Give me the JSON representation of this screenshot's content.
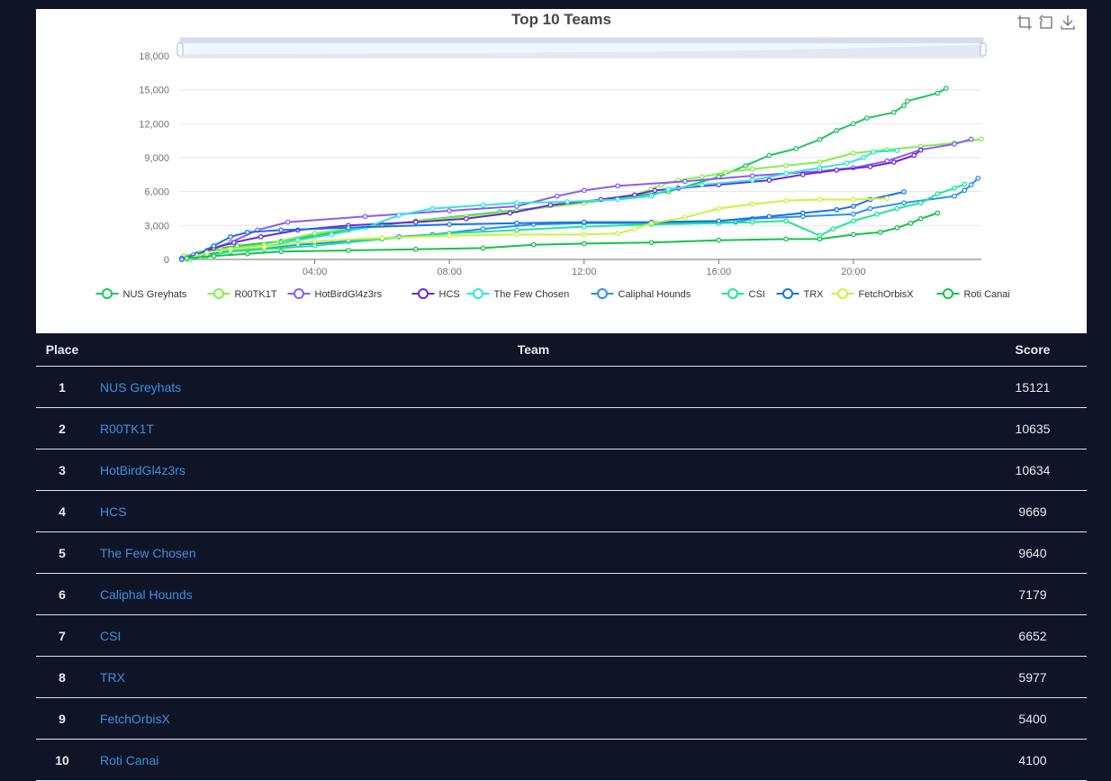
{
  "colors": {
    "page_bg": "#0f1527",
    "link": "#3d8fe0",
    "series": [
      "#22c55e",
      "#84ef4a",
      "#8b5cf6",
      "#6d28d9",
      "#2ee6de",
      "#2b8ff0",
      "#1ee88f",
      "#1673e6",
      "#cdf23e",
      "#16c24a"
    ]
  },
  "toolbox": {
    "icons": [
      "zoom-area-icon",
      "zoom-reset-icon",
      "download-icon"
    ]
  },
  "chart_data": {
    "type": "line",
    "title": "Top 10 Teams",
    "xlabel": "",
    "ylabel": "",
    "xlim": [
      0,
      23.8
    ],
    "ylim": [
      0,
      18000
    ],
    "yticks": [
      0,
      3000,
      6000,
      9000,
      12000,
      15000,
      18000
    ],
    "ytick_labels": [
      "0",
      "3,000",
      "6,000",
      "9,000",
      "12,000",
      "15,000",
      "18,000"
    ],
    "xticks": [
      4,
      8,
      12,
      16,
      20
    ],
    "xtick_labels": [
      "04:00",
      "08:00",
      "12:00",
      "16:00",
      "20:00"
    ],
    "grid": true,
    "legend_position": "bottom",
    "series": [
      {
        "name": "NUS Greyhats",
        "points": [
          [
            0.1,
            200
          ],
          [
            0.5,
            500
          ],
          [
            1.0,
            900
          ],
          [
            1.7,
            1200
          ],
          [
            3.0,
            1600
          ],
          [
            5.0,
            2600
          ],
          [
            7.0,
            3400
          ],
          [
            9.5,
            4200
          ],
          [
            12.0,
            5000
          ],
          [
            14.5,
            6000
          ],
          [
            16.0,
            7300
          ],
          [
            16.8,
            8300
          ],
          [
            17.5,
            9200
          ],
          [
            18.3,
            9800
          ],
          [
            19.0,
            10600
          ],
          [
            19.5,
            11400
          ],
          [
            20.0,
            12000
          ],
          [
            20.4,
            12500
          ],
          [
            21.2,
            13000
          ],
          [
            21.5,
            13600
          ],
          [
            21.6,
            14000
          ],
          [
            22.5,
            14700
          ],
          [
            22.75,
            15121
          ]
        ]
      },
      {
        "name": "R00TK1T",
        "points": [
          [
            0.1,
            300
          ],
          [
            0.6,
            600
          ],
          [
            1.2,
            900
          ],
          [
            2.5,
            1300
          ],
          [
            4.0,
            2300
          ],
          [
            6.0,
            3100
          ],
          [
            8.5,
            3800
          ],
          [
            10.0,
            4300
          ],
          [
            12.0,
            5000
          ],
          [
            13.5,
            5700
          ],
          [
            14.0,
            6200
          ],
          [
            14.3,
            6600
          ],
          [
            14.8,
            7000
          ],
          [
            15.5,
            7300
          ],
          [
            16.2,
            7700
          ],
          [
            17.0,
            8000
          ],
          [
            18.0,
            8300
          ],
          [
            19.0,
            8600
          ],
          [
            20.0,
            9400
          ],
          [
            21.0,
            9700
          ],
          [
            22.0,
            10000
          ],
          [
            23.0,
            10300
          ],
          [
            23.8,
            10635
          ]
        ]
      },
      {
        "name": "HotBirdGl4z3rs",
        "points": [
          [
            0.05,
            100
          ],
          [
            0.4,
            400
          ],
          [
            0.8,
            800
          ],
          [
            1.5,
            1500
          ],
          [
            2.3,
            2600
          ],
          [
            3.2,
            3300
          ],
          [
            5.5,
            3800
          ],
          [
            8.0,
            4300
          ],
          [
            10.0,
            4700
          ],
          [
            11.2,
            5600
          ],
          [
            12.0,
            6100
          ],
          [
            13.0,
            6500
          ],
          [
            15.0,
            6900
          ],
          [
            17.0,
            7400
          ],
          [
            19.0,
            7800
          ],
          [
            20.0,
            8100
          ],
          [
            21.0,
            8700
          ],
          [
            22.0,
            9700
          ],
          [
            23.0,
            10200
          ],
          [
            23.5,
            10634
          ]
        ]
      },
      {
        "name": "HCS",
        "points": [
          [
            0.05,
            0
          ],
          [
            0.5,
            400
          ],
          [
            1.0,
            1000
          ],
          [
            1.6,
            1500
          ],
          [
            2.4,
            2000
          ],
          [
            3.5,
            2600
          ],
          [
            5.0,
            3000
          ],
          [
            7.0,
            3300
          ],
          [
            8.5,
            3600
          ],
          [
            9.8,
            4100
          ],
          [
            11.0,
            4800
          ],
          [
            12.5,
            5300
          ],
          [
            13.5,
            5700
          ],
          [
            14.1,
            6100
          ],
          [
            14.8,
            6300
          ],
          [
            16.0,
            6600
          ],
          [
            17.5,
            7000
          ],
          [
            18.5,
            7500
          ],
          [
            19.5,
            7900
          ],
          [
            20.5,
            8200
          ],
          [
            21.2,
            8600
          ],
          [
            21.8,
            9200
          ],
          [
            22.0,
            9669
          ]
        ]
      },
      {
        "name": "The Few Chosen",
        "points": [
          [
            0.3,
            0
          ],
          [
            0.7,
            300
          ],
          [
            1.5,
            700
          ],
          [
            2.5,
            1100
          ],
          [
            3.5,
            1700
          ],
          [
            4.5,
            2200
          ],
          [
            5.5,
            2800
          ],
          [
            6.5,
            3900
          ],
          [
            7.5,
            4500
          ],
          [
            9.0,
            4800
          ],
          [
            10.0,
            5000
          ],
          [
            11.5,
            5100
          ],
          [
            13.0,
            5300
          ],
          [
            14.0,
            5600
          ],
          [
            14.5,
            6200
          ],
          [
            15.5,
            6600
          ],
          [
            17.0,
            7000
          ],
          [
            18.0,
            7600
          ],
          [
            19.0,
            8100
          ],
          [
            19.8,
            8500
          ],
          [
            20.3,
            9000
          ],
          [
            20.6,
            9500
          ],
          [
            21.3,
            9640
          ]
        ]
      },
      {
        "name": "Caliphal Hounds",
        "points": [
          [
            0.05,
            100
          ],
          [
            0.6,
            400
          ],
          [
            1.2,
            700
          ],
          [
            2.5,
            1000
          ],
          [
            3.5,
            1300
          ],
          [
            5.0,
            1600
          ],
          [
            6.5,
            2000
          ],
          [
            7.5,
            2200
          ],
          [
            9.0,
            2700
          ],
          [
            10.5,
            3100
          ],
          [
            12.0,
            3200
          ],
          [
            14.0,
            3200
          ],
          [
            16.5,
            3300
          ],
          [
            17.0,
            3600
          ],
          [
            18.5,
            3800
          ],
          [
            20.0,
            4000
          ],
          [
            20.5,
            4500
          ],
          [
            21.5,
            5000
          ],
          [
            23.0,
            5600
          ],
          [
            23.3,
            6100
          ],
          [
            23.5,
            6600
          ],
          [
            23.7,
            7179
          ]
        ]
      },
      {
        "name": "CSI",
        "points": [
          [
            0.2,
            0
          ],
          [
            0.8,
            300
          ],
          [
            1.5,
            700
          ],
          [
            2.5,
            900
          ],
          [
            4.0,
            1200
          ],
          [
            6.0,
            1800
          ],
          [
            8.0,
            2300
          ],
          [
            10.0,
            2600
          ],
          [
            12.0,
            2900
          ],
          [
            14.0,
            3100
          ],
          [
            16.0,
            3200
          ],
          [
            17.0,
            3300
          ],
          [
            18.0,
            3400
          ],
          [
            19.0,
            2100
          ],
          [
            19.4,
            2700
          ],
          [
            20.0,
            3400
          ],
          [
            20.7,
            4000
          ],
          [
            21.3,
            4500
          ],
          [
            22.0,
            5000
          ],
          [
            22.5,
            5800
          ],
          [
            23.0,
            6300
          ],
          [
            23.3,
            6652
          ]
        ]
      },
      {
        "name": "TRX",
        "points": [
          [
            0.05,
            0
          ],
          [
            0.5,
            400
          ],
          [
            1.0,
            1200
          ],
          [
            1.5,
            2000
          ],
          [
            2.0,
            2400
          ],
          [
            3.0,
            2600
          ],
          [
            5.0,
            2800
          ],
          [
            8.0,
            3100
          ],
          [
            10.0,
            3200
          ],
          [
            12.0,
            3300
          ],
          [
            14.0,
            3300
          ],
          [
            16.0,
            3400
          ],
          [
            17.5,
            3800
          ],
          [
            18.5,
            4100
          ],
          [
            19.5,
            4400
          ],
          [
            20.0,
            4700
          ],
          [
            20.5,
            5300
          ],
          [
            21.5,
            5977
          ]
        ]
      },
      {
        "name": "FetchOrbisX",
        "points": [
          [
            0.2,
            0
          ],
          [
            0.8,
            600
          ],
          [
            1.5,
            900
          ],
          [
            2.5,
            1100
          ],
          [
            4.0,
            1600
          ],
          [
            6.0,
            1900
          ],
          [
            8.0,
            2100
          ],
          [
            10.0,
            2200
          ],
          [
            12.0,
            2200
          ],
          [
            13.0,
            2300
          ],
          [
            13.5,
            2700
          ],
          [
            14.0,
            3200
          ],
          [
            15.0,
            3700
          ],
          [
            16.0,
            4500
          ],
          [
            17.0,
            4900
          ],
          [
            18.0,
            5200
          ],
          [
            19.0,
            5300
          ],
          [
            20.0,
            5300
          ],
          [
            21.0,
            5400
          ]
        ]
      },
      {
        "name": "Roti Canai",
        "points": [
          [
            0.2,
            100
          ],
          [
            1.0,
            300
          ],
          [
            2.0,
            500
          ],
          [
            3.0,
            700
          ],
          [
            5.0,
            800
          ],
          [
            7.0,
            900
          ],
          [
            9.0,
            1000
          ],
          [
            10.5,
            1300
          ],
          [
            12.0,
            1400
          ],
          [
            14.0,
            1500
          ],
          [
            16.0,
            1700
          ],
          [
            18.0,
            1800
          ],
          [
            19.0,
            1800
          ],
          [
            20.0,
            2200
          ],
          [
            20.8,
            2400
          ],
          [
            21.3,
            2800
          ],
          [
            21.7,
            3200
          ],
          [
            22.0,
            3600
          ],
          [
            22.5,
            4100
          ]
        ]
      }
    ]
  },
  "table": {
    "headers": {
      "place": "Place",
      "team": "Team",
      "score": "Score"
    },
    "rows": [
      {
        "place": "1",
        "team": "NUS Greyhats",
        "score": "15121"
      },
      {
        "place": "2",
        "team": "R00TK1T",
        "score": "10635"
      },
      {
        "place": "3",
        "team": "HotBirdGl4z3rs",
        "score": "10634"
      },
      {
        "place": "4",
        "team": "HCS",
        "score": "9669"
      },
      {
        "place": "5",
        "team": "The Few Chosen",
        "score": "9640"
      },
      {
        "place": "6",
        "team": "Caliphal Hounds",
        "score": "7179"
      },
      {
        "place": "7",
        "team": "CSI",
        "score": "6652"
      },
      {
        "place": "8",
        "team": "TRX",
        "score": "5977"
      },
      {
        "place": "9",
        "team": "FetchOrbisX",
        "score": "5400"
      },
      {
        "place": "10",
        "team": "Roti Canai",
        "score": "4100"
      }
    ]
  }
}
